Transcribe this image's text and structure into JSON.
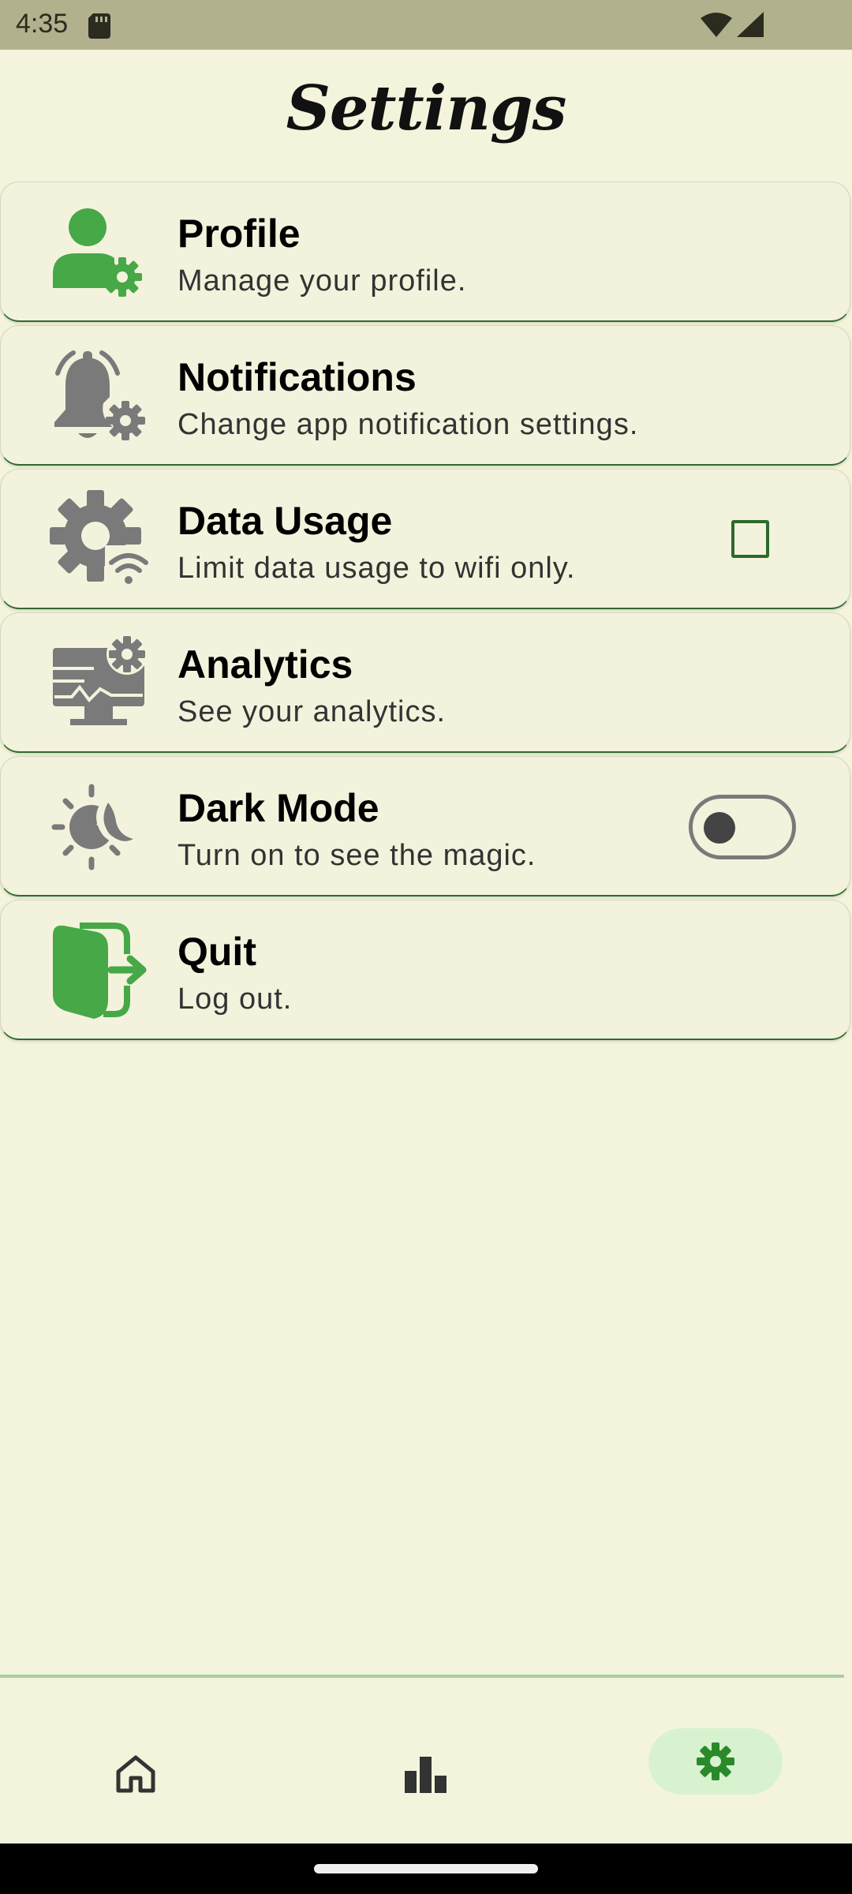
{
  "status_bar": {
    "time": "4:35",
    "icons": [
      "sd-card-icon",
      "wifi-icon",
      "signal-icon"
    ]
  },
  "header": {
    "title": "Settings"
  },
  "settings": [
    {
      "id": "profile",
      "title": "Profile",
      "subtitle": "Manage your profile.",
      "icon": "profile-settings-icon",
      "icon_color": "#46a846"
    },
    {
      "id": "notifications",
      "title": "Notifications",
      "subtitle": "Change app notification settings.",
      "icon": "notification-settings-icon",
      "icon_color": "#7a7a7a"
    },
    {
      "id": "data-usage",
      "title": "Data Usage",
      "subtitle": "Limit data usage to wifi only.",
      "icon": "data-usage-gear-icon",
      "icon_color": "#7a7a7a",
      "control": "checkbox",
      "checked": false
    },
    {
      "id": "analytics",
      "title": "Analytics",
      "subtitle": "See your analytics.",
      "icon": "analytics-monitor-icon",
      "icon_color": "#7a7a7a"
    },
    {
      "id": "dark-mode",
      "title": "Dark Mode",
      "subtitle": "Turn on to see the magic.",
      "icon": "sun-moon-icon",
      "icon_color": "#7a7a7a",
      "control": "toggle",
      "on": false
    },
    {
      "id": "quit",
      "title": "Quit",
      "subtitle": "Log out.",
      "icon": "logout-door-icon",
      "icon_color": "#46a846"
    }
  ],
  "bottom_nav": {
    "items": [
      {
        "id": "home",
        "icon": "home-icon",
        "selected": false
      },
      {
        "id": "stats",
        "icon": "bar-chart-icon",
        "selected": false
      },
      {
        "id": "settings",
        "icon": "gear-icon",
        "selected": true
      }
    ]
  },
  "colors": {
    "background": "#f4f4dc",
    "status_bar": "#b1b28d",
    "accent_green": "#46a846",
    "row_border": "#2f6b2f",
    "nav_selected_bg": "#d8f2d0"
  }
}
